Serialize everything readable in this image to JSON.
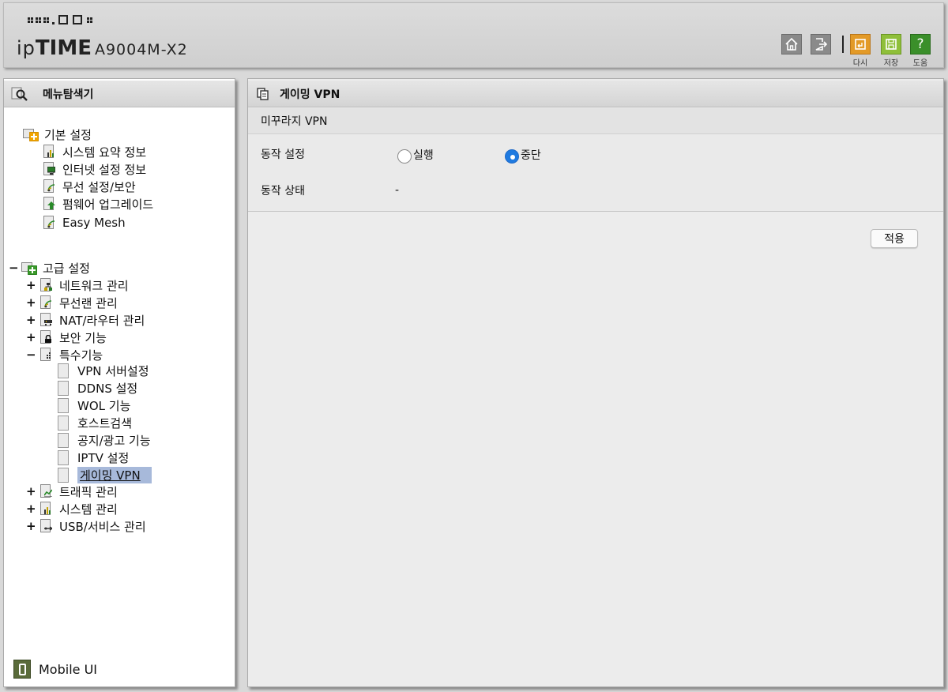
{
  "header": {
    "brand": {
      "ip": "ip",
      "time": "TIME",
      "model": "A9004M-X2"
    },
    "buttons": {
      "home": {
        "icon": "home-icon"
      },
      "logout": {
        "icon": "logout-icon"
      },
      "reload": {
        "icon": "reload-icon",
        "label": "다시"
      },
      "save": {
        "icon": "save-icon",
        "label": "저장"
      },
      "help": {
        "icon": "help-icon",
        "glyph": "?",
        "label": "도움"
      }
    }
  },
  "sidebar": {
    "title": "메뉴탐색기",
    "basic": {
      "label": "기본 설정",
      "items": [
        "시스템 요약 정보",
        "인터넷 설정 정보",
        "무선 설정/보안",
        "펌웨어 업그레이드",
        "Easy Mesh"
      ]
    },
    "advanced": {
      "label": "고급 설정",
      "groups": [
        {
          "label": "네트워크 관리",
          "toggle": "+"
        },
        {
          "label": "무선랜 관리",
          "toggle": "+"
        },
        {
          "label": "NAT/라우터 관리",
          "toggle": "+"
        },
        {
          "label": "보안 기능",
          "toggle": "+"
        },
        {
          "label": "특수기능",
          "toggle": "−"
        },
        {
          "label": "트래픽 관리",
          "toggle": "+"
        },
        {
          "label": "시스템 관리",
          "toggle": "+"
        },
        {
          "label": "USB/서비스 관리",
          "toggle": "+"
        }
      ],
      "special_items": [
        "VPN 서버설정",
        "DDNS 설정",
        "WOL 기능",
        "호스트검색",
        "공지/광고 기능",
        "IPTV 설정",
        "게이밍 VPN"
      ]
    },
    "toggles": {
      "collapse": "−"
    },
    "selected": "게이밍 VPN",
    "mobile_ui": "Mobile UI"
  },
  "main": {
    "title": "게이밍 VPN",
    "section": "미꾸라지 VPN",
    "operation_label": "동작 설정",
    "options": {
      "run": "실행",
      "stop": "중단"
    },
    "selected_option": "중단",
    "status_label": "동작 상태",
    "status_value": "-",
    "apply_label": "적용"
  },
  "colors": {
    "selection": "#a7b9da",
    "reload": "#e39a27",
    "save": "#8fbf3a",
    "help": "#3a8f2a",
    "radio_checked": "#1f7ae0"
  }
}
